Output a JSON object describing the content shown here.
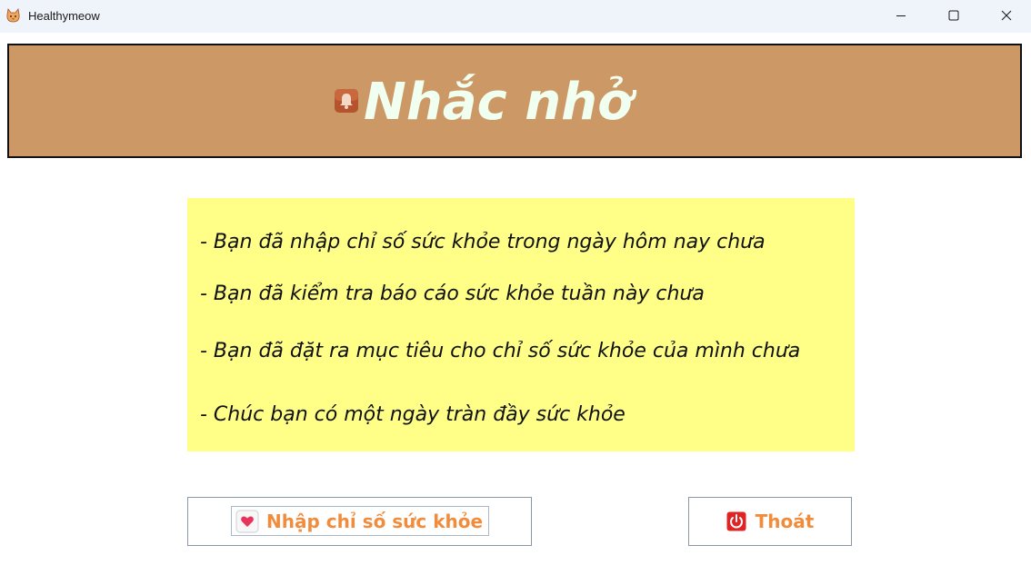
{
  "window": {
    "title": "Healthymeow",
    "icons": {
      "app": "cat-icon",
      "minimize": "minimize-icon",
      "maximize": "maximize-icon",
      "close": "close-icon"
    }
  },
  "header": {
    "title": "Nhắc nhở",
    "icon": "bell-icon",
    "background": "#cc9966",
    "title_color": "#f0fff0"
  },
  "reminders": {
    "background": "#ffff88",
    "items": [
      "- Bạn đã nhập chỉ số sức khỏe trong ngày hôm nay chưa",
      "- Bạn đã kiểm tra báo cáo sức khỏe tuần này chưa",
      "- Bạn đã đặt ra mục tiêu cho chỉ số sức khỏe của mình chưa",
      "- Chúc bạn có một ngày tràn đầy sức khỏe"
    ]
  },
  "buttons": {
    "enter_health": {
      "label": "Nhập chỉ số sức khỏe",
      "icon": "heart-calendar-icon"
    },
    "exit": {
      "label": "Thoát",
      "icon": "power-icon"
    },
    "label_color": "#f08c3c"
  }
}
